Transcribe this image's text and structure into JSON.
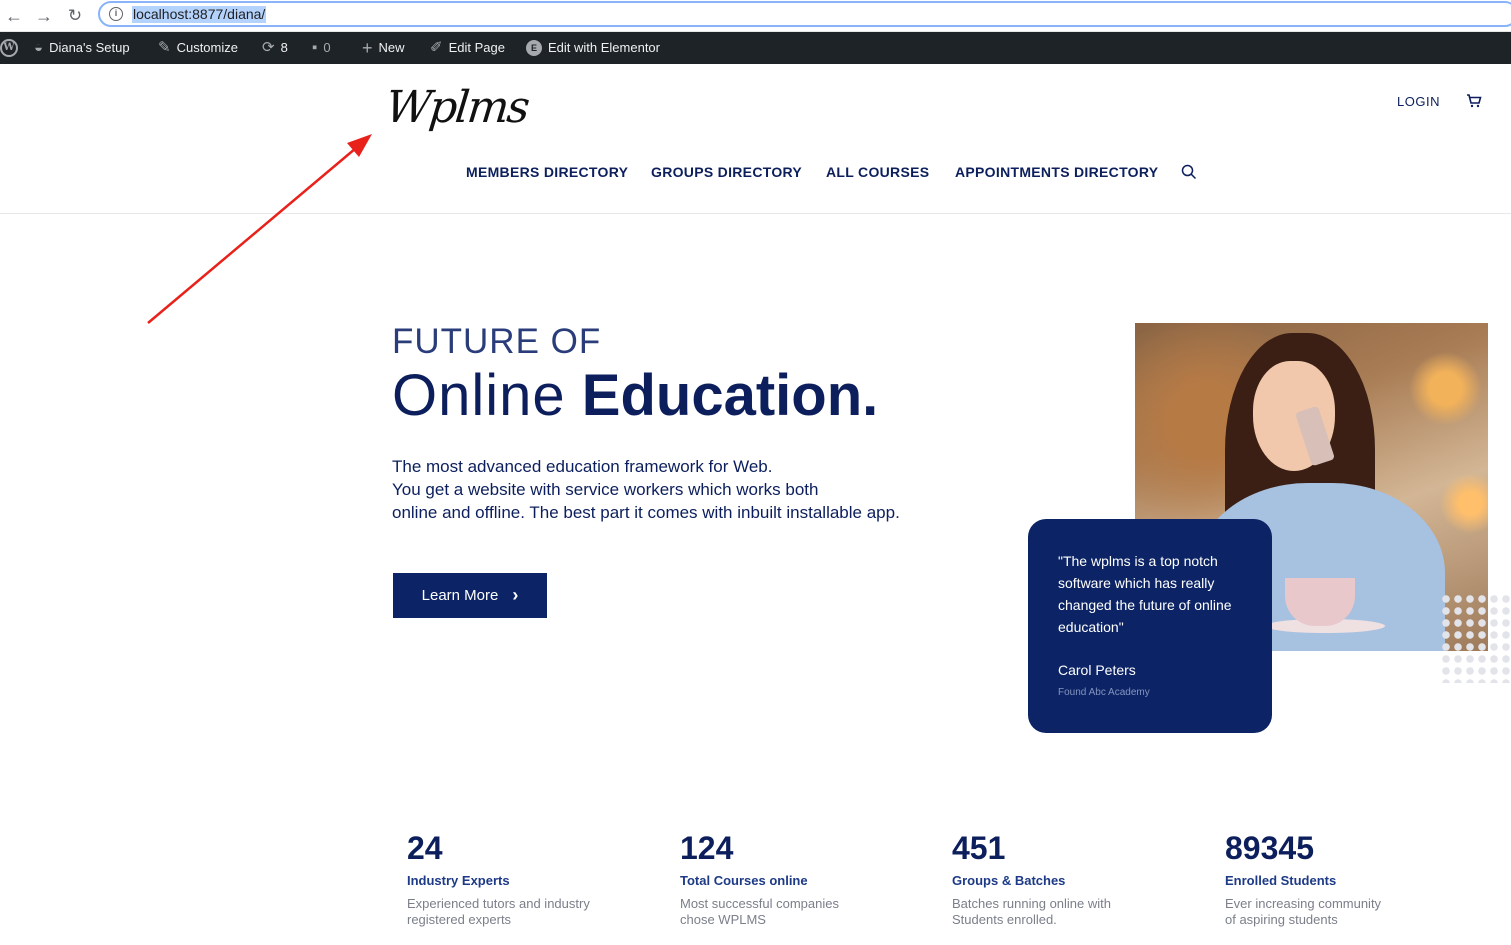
{
  "browser": {
    "url": "localhost:8877/diana/",
    "back_icon": "arrow-left-icon",
    "forward_icon": "arrow-right-icon",
    "reload_icon": "reload-icon"
  },
  "admin_bar": {
    "site_name": "Diana's Setup",
    "customize": "Customize",
    "updates_count": "8",
    "comments_count": "0",
    "new": "New",
    "edit_page": "Edit Page",
    "edit_elementor": "Edit with Elementor"
  },
  "header": {
    "logo_text": "Wplms",
    "login": "LOGIN",
    "nav": [
      "MEMBERS DIRECTORY",
      "GROUPS DIRECTORY",
      "ALL COURSES",
      "APPOINTMENTS DIRECTORY"
    ]
  },
  "hero": {
    "eyebrow": "FUTURE OF",
    "title_light": "Online",
    "title_bold": "Education.",
    "desc_lines": [
      "The most advanced education framework for Web.",
      "You get a website with service workers which works both",
      "online and offline. The best part it comes with inbuilt installable app."
    ],
    "button": "Learn More"
  },
  "testimonial": {
    "quote_lines": [
      "\"The wplms is a top notch",
      "software which has really",
      "changed the future of online",
      "education\""
    ],
    "author": "Carol Peters",
    "role": "Found Abc Academy"
  },
  "stats": [
    {
      "number": "24",
      "label": "Industry Experts",
      "desc_lines": [
        "Experienced tutors and industry",
        "registered experts"
      ]
    },
    {
      "number": "124",
      "label": "Total Courses online",
      "desc_lines": [
        "Most successful companies",
        "chose WPLMS"
      ]
    },
    {
      "number": "451",
      "label": "Groups & Batches",
      "desc_lines": [
        "Batches running online with",
        "Students enrolled."
      ]
    },
    {
      "number": "89345",
      "label": "Enrolled Students",
      "desc_lines": [
        "Ever increasing community",
        "of aspiring students"
      ]
    }
  ],
  "colors": {
    "navy": "#0c2465",
    "text": "#0c1f5c",
    "annotation": "#e8221b",
    "admin_bar": "#1d2327"
  }
}
